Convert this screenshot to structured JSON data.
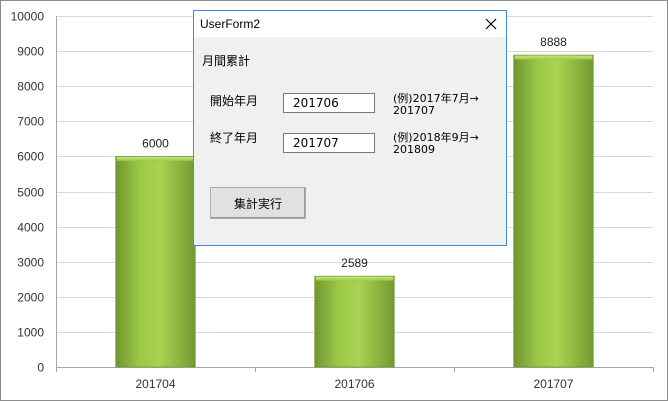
{
  "chart_data": {
    "type": "bar",
    "categories": [
      "201704",
      "201706",
      "201707"
    ],
    "values": [
      6000,
      2589,
      8888
    ],
    "ylim": [
      0,
      10000
    ],
    "yticks": [
      0,
      1000,
      2000,
      3000,
      4000,
      5000,
      6000,
      7000,
      8000,
      9000,
      10000
    ],
    "grid": true,
    "legend": "none",
    "bar_color": "#8cb53d"
  },
  "form": {
    "title": "UserForm2",
    "heading": "月間累計",
    "start": {
      "label": "開始年月",
      "value": "201706",
      "hint1": "(例)2017年7月→",
      "hint2": "201707"
    },
    "end": {
      "label": "終了年月",
      "value": "201707",
      "hint1": "(例)2018年9月→",
      "hint2": "201809"
    },
    "run_label": "集計実行",
    "accent": "#3c8fd4"
  }
}
